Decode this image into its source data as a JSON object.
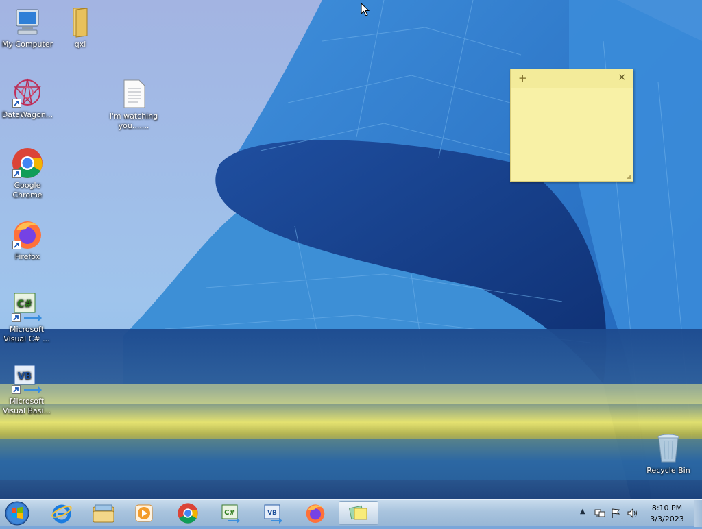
{
  "desktop": {
    "icons": [
      {
        "id": "my-computer",
        "label": "My Computer"
      },
      {
        "id": "qxl",
        "label": "qxl"
      },
      {
        "id": "datawagon",
        "label": "DataWagon..."
      },
      {
        "id": "watching",
        "label": "i'm watching you......."
      },
      {
        "id": "chrome",
        "label": "Google Chrome"
      },
      {
        "id": "firefox",
        "label": "Firefox"
      },
      {
        "id": "vcsharp",
        "label": "Microsoft Visual C# ..."
      },
      {
        "id": "vbasic",
        "label": "Microsoft Visual Basi..."
      },
      {
        "id": "recycle",
        "label": "Recycle Bin"
      }
    ]
  },
  "sticky_note": {
    "text": "",
    "add_symbol": "+",
    "close_symbol": "×"
  },
  "taskbar": {
    "pinned": [
      "internet-explorer-icon",
      "file-explorer-icon",
      "media-player-icon",
      "chrome-icon",
      "visual-csharp-icon",
      "visual-basic-icon",
      "firefox-icon",
      "sticky-notes-icon"
    ],
    "clock": {
      "time": "8:10 PM",
      "date": "3/3/2023"
    }
  },
  "colors": {
    "sticky": "#f8f1a6",
    "taskbar": "#a9c4de",
    "sky": "#9db8e6",
    "building": "#2f7fd0"
  }
}
